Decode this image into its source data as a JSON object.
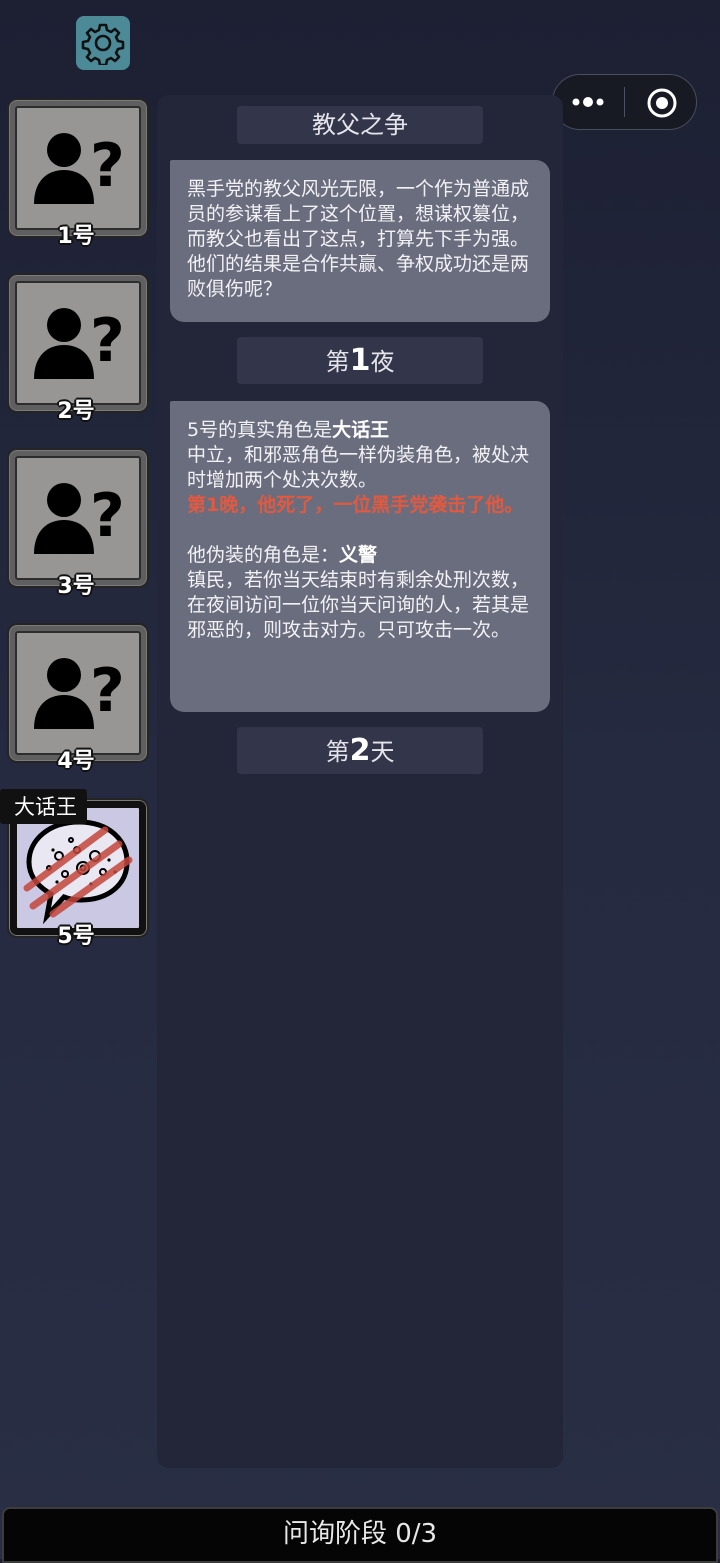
{
  "system": {
    "settings_icon": "gear-icon",
    "more_icon": "more-dots-icon",
    "close_icon": "target-circle-icon"
  },
  "players": [
    {
      "number": "1号",
      "avatar": "unknown-player-icon",
      "revealed": false
    },
    {
      "number": "2号",
      "avatar": "unknown-player-icon",
      "revealed": false
    },
    {
      "number": "3号",
      "avatar": "unknown-player-icon",
      "revealed": false
    },
    {
      "number": "4号",
      "avatar": "unknown-player-icon",
      "revealed": false
    },
    {
      "number": "5号",
      "avatar": "speech-bubble-claw-icon",
      "revealed": true,
      "role_tag": "大话王",
      "status": "dead"
    }
  ],
  "log": {
    "title": "教父之争",
    "intro": "黑手党的教父风光无限，一个作为普通成员的参谋看上了这个位置，想谋权篡位，而教父也看出了这点，打算先下手为强。他们的结果是合作共赢、争权成功还是两败俱伤呢？",
    "night1": {
      "prefix": "第",
      "num": "1",
      "suffix": "夜"
    },
    "reveal": {
      "line1_prefix": "5号的真实角色是",
      "line1_role": "大话王",
      "role_desc": "中立，和邪恶角色一样伪装角色，被处决时增加两个处决次数。",
      "death_notice": "第1晚，他死了，一位黑手党袭击了他。",
      "disguise_prefix": "他伪装的角色是：",
      "disguise_role": "义警",
      "disguise_desc": "镇民，若你当天结束时有剩余处刑次数，在夜间访问一位你当天问询的人，若其是邪恶的，则攻击对方。只可攻击一次。"
    },
    "day2": {
      "prefix": "第",
      "num": "2",
      "suffix": "天"
    }
  },
  "phase": {
    "label": "问询阶段 0/3"
  },
  "colors": {
    "accent_red": "#e3593f",
    "settings_bg": "#4c8a98",
    "bubble_bg": "#6a6d7e"
  }
}
